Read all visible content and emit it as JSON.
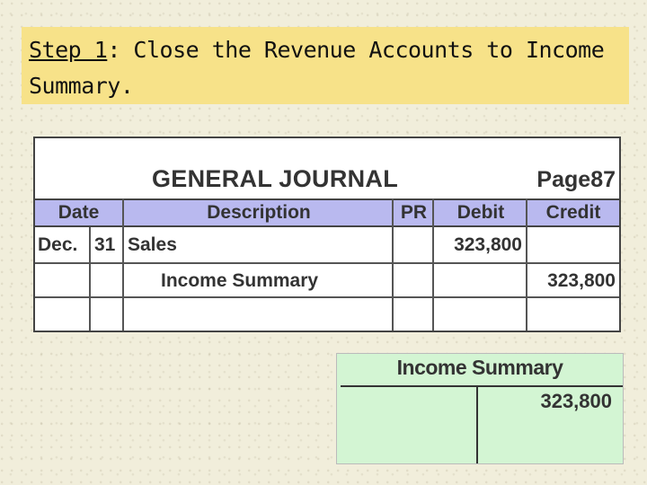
{
  "slide": {
    "title_underlined": "Step 1",
    "title_rest": ": Close the Revenue Accounts to Income Summary."
  },
  "journal": {
    "title": "GENERAL JOURNAL",
    "page_label": "Page",
    "page_number": "87",
    "headers": {
      "date": "Date",
      "description": "Description",
      "pr": "PR",
      "debit": "Debit",
      "credit": "Credit"
    },
    "rows": [
      {
        "month": "Dec.",
        "day": "31",
        "description": "Sales",
        "pr": "",
        "debit": "323,800",
        "credit": ""
      },
      {
        "month": "",
        "day": "",
        "description": "Income Summary",
        "pr": "",
        "debit": "",
        "credit": "323,800"
      },
      {
        "month": "",
        "day": "",
        "description": "",
        "pr": "",
        "debit": "",
        "credit": ""
      }
    ]
  },
  "ledger": {
    "title": "Income Summary",
    "debit": "",
    "credit": "323,800"
  },
  "colors": {
    "title_bg": "#f7e289",
    "header_bg": "#b9b9ef",
    "ledger_bg": "#d3f5d3",
    "slide_bg": "#f1eedb"
  }
}
